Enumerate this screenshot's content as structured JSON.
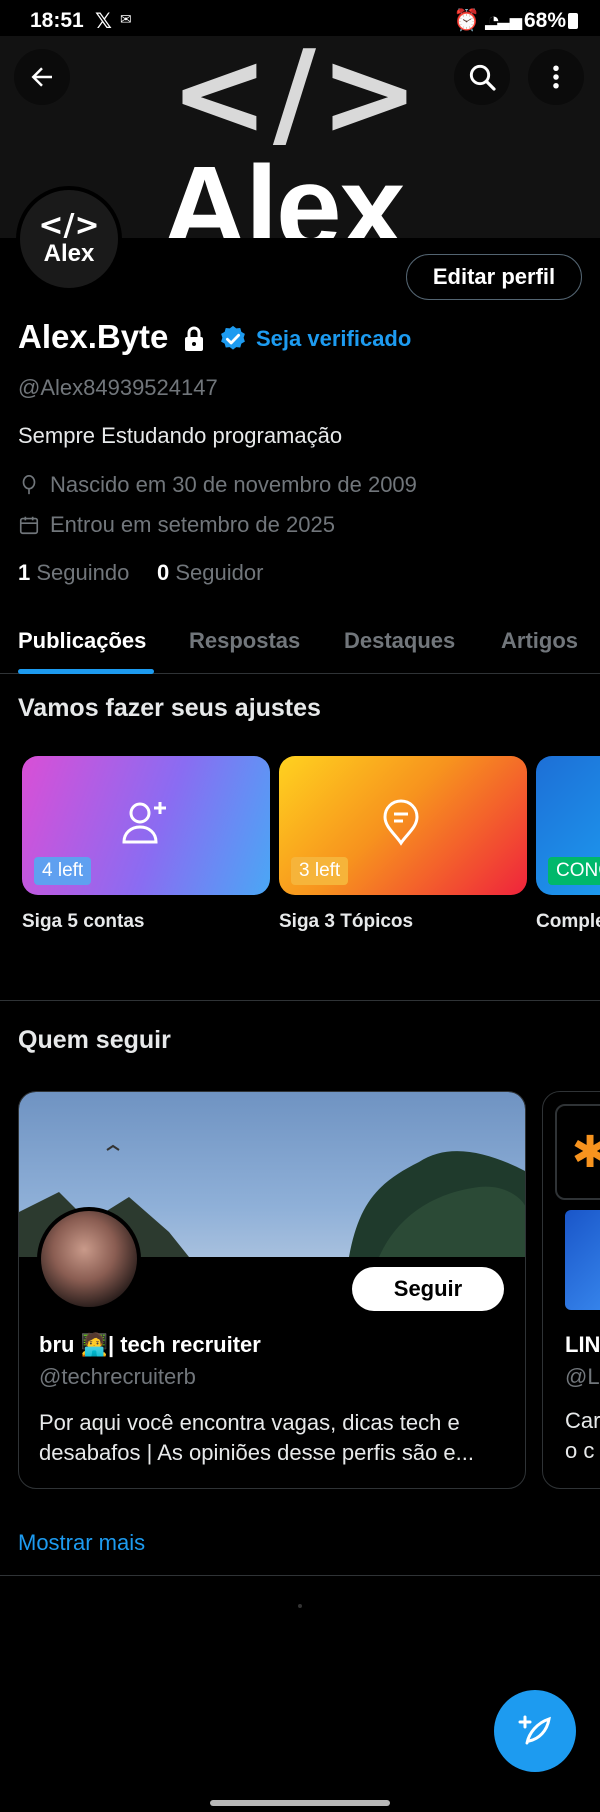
{
  "status_bar": {
    "time": "18:51",
    "battery": "68%"
  },
  "banner": {
    "code_text": "</>",
    "word_text": "Alex"
  },
  "avatar": {
    "line1": "</>",
    "line2": "Alex"
  },
  "profile": {
    "edit_label": "Editar perfil",
    "name": "Alex.Byte",
    "verify_label": "Seja verificado",
    "handle": "@Alex84939524147",
    "bio": "Sempre Estudando programação",
    "birth": "Nascido em 30 de novembro de 2009",
    "joined": "Entrou em setembro de 2025",
    "following_count": "1",
    "following_label": "Seguindo",
    "followers_count": "0",
    "followers_label": "Seguidor"
  },
  "tabs": [
    "Publicações",
    "Respostas",
    "Destaques",
    "Artigos"
  ],
  "setup": {
    "title": "Vamos fazer seus ajustes",
    "cards": [
      {
        "chip": "4 left",
        "label": "Siga 5 contas"
      },
      {
        "chip": "3 left",
        "label": "Siga 3 Tópicos"
      },
      {
        "chip": "CONC",
        "label": "Comple"
      }
    ]
  },
  "who_to_follow": {
    "title": "Quem seguir",
    "card": {
      "follow_label": "Seguir",
      "name": "bru 🧑‍💻| tech recruiter",
      "handle": "@techrecruiterb",
      "bio": "Por aqui você encontra vagas, dicas tech e desabafos | As opiniões desse perfis são e..."
    },
    "peek": {
      "name": "LIN",
      "handle": "@L",
      "bio1": "Car",
      "bio2": "o c"
    },
    "show_more": "Mostrar mais"
  },
  "colors": {
    "accent": "#1d9bf0",
    "background": "#000000"
  }
}
